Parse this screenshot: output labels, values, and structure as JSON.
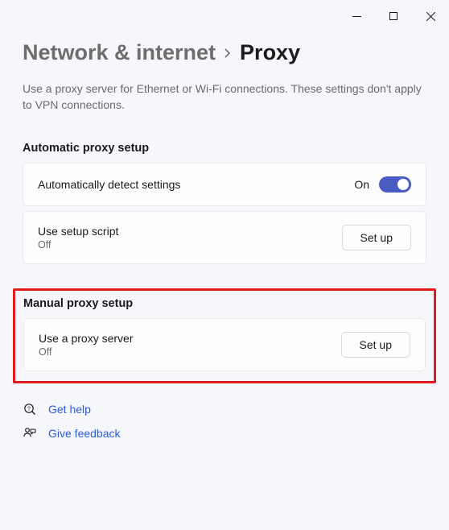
{
  "breadcrumb": {
    "parent": "Network & internet",
    "current": "Proxy"
  },
  "description": "Use a proxy server for Ethernet or Wi-Fi connections. These settings don't apply to VPN connections.",
  "auto_section": {
    "title": "Automatic proxy setup",
    "detect": {
      "label": "Automatically detect settings",
      "state_text": "On"
    },
    "script": {
      "label": "Use setup script",
      "state_text": "Off",
      "button": "Set up"
    }
  },
  "manual_section": {
    "title": "Manual proxy setup",
    "proxy": {
      "label": "Use a proxy server",
      "state_text": "Off",
      "button": "Set up"
    }
  },
  "links": {
    "help": "Get help",
    "feedback": "Give feedback"
  }
}
